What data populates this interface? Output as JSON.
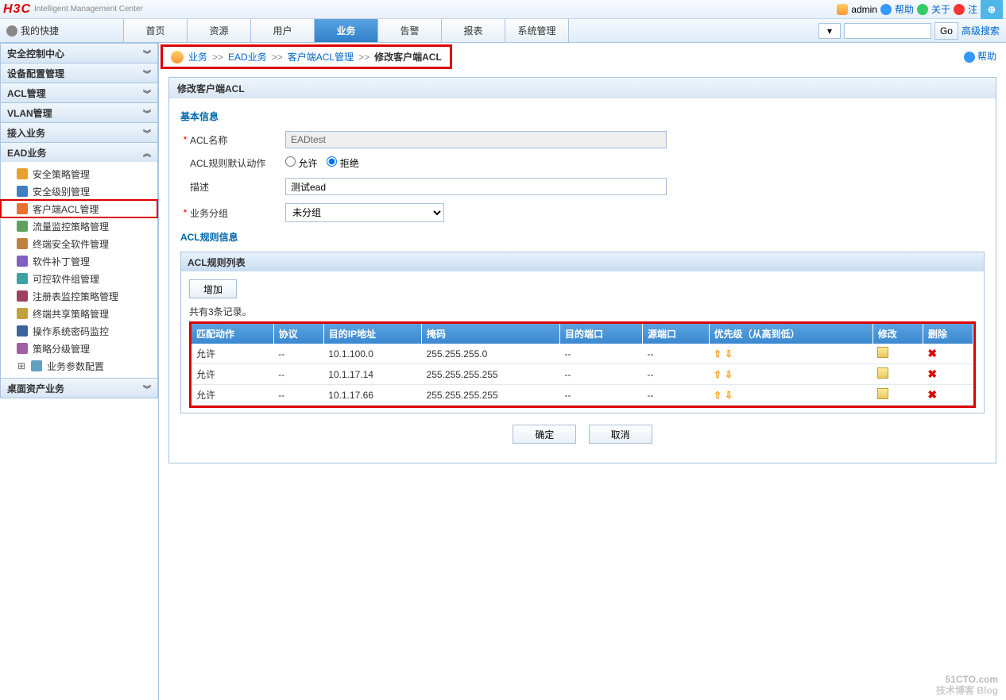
{
  "brand": {
    "logo": "H3C",
    "sub": "Intelligent Management Center"
  },
  "top": {
    "user": "admin",
    "help": "帮助",
    "about": "关于",
    "logout": "注"
  },
  "fav": "我的快捷",
  "nav": {
    "tabs": [
      "首页",
      "资源",
      "用户",
      "业务",
      "告警",
      "报表",
      "系统管理"
    ],
    "active": 3,
    "go": "Go",
    "adv": "高级搜索"
  },
  "side_sections": [
    {
      "title": "安全控制中心",
      "open": false
    },
    {
      "title": "设备配置管理",
      "open": false
    },
    {
      "title": "ACL管理",
      "open": false
    },
    {
      "title": "VLAN管理",
      "open": false
    },
    {
      "title": "接入业务",
      "open": false
    },
    {
      "title": "EAD业务",
      "open": true,
      "items": [
        "安全策略管理",
        "安全级别管理",
        "客户端ACL管理",
        "流量监控策略管理",
        "终端安全软件管理",
        "软件补丁管理",
        "可控软件组管理",
        "注册表监控策略管理",
        "终端共享策略管理",
        "操作系统密码监控",
        "策略分级管理",
        "业务参数配置"
      ],
      "selected": 2
    },
    {
      "title": "桌面资产业务",
      "open": false
    }
  ],
  "breadcrumb": {
    "items": [
      "业务",
      "EAD业务",
      "客户端ACL管理",
      "修改客户端ACL"
    ],
    "sep": ">>",
    "help": "帮助"
  },
  "panel_title": "修改客户端ACL",
  "form": {
    "section_basic": "基本信息",
    "acl_name_label": "ACL名称",
    "acl_name_value": "EADtest",
    "default_action_label": "ACL规则默认动作",
    "allow": "允许",
    "deny": "拒绝",
    "desc_label": "描述",
    "desc_value": "测试ead",
    "group_label": "业务分组",
    "group_value": "未分组",
    "section_rules": "ACL规则信息",
    "rule_list_title": "ACL规则列表",
    "add_btn": "增加",
    "rec_count": "共有3条记录。"
  },
  "table": {
    "headers": [
      "匹配动作",
      "协议",
      "目的IP地址",
      "掩码",
      "目的端口",
      "源端口",
      "优先级（从高到低）",
      "修改",
      "删除"
    ],
    "rows": [
      {
        "action": "允许",
        "proto": "--",
        "dip": "10.1.100.0",
        "mask": "255.255.255.0",
        "dport": "--",
        "sport": "--"
      },
      {
        "action": "允许",
        "proto": "--",
        "dip": "10.1.17.14",
        "mask": "255.255.255.255",
        "dport": "--",
        "sport": "--"
      },
      {
        "action": "允许",
        "proto": "--",
        "dip": "10.1.17.66",
        "mask": "255.255.255.255",
        "dport": "--",
        "sport": "--"
      }
    ]
  },
  "buttons": {
    "ok": "确定",
    "cancel": "取消"
  },
  "watermark": {
    "main": "51CTO.com",
    "sub": "技术博客  Blog"
  }
}
